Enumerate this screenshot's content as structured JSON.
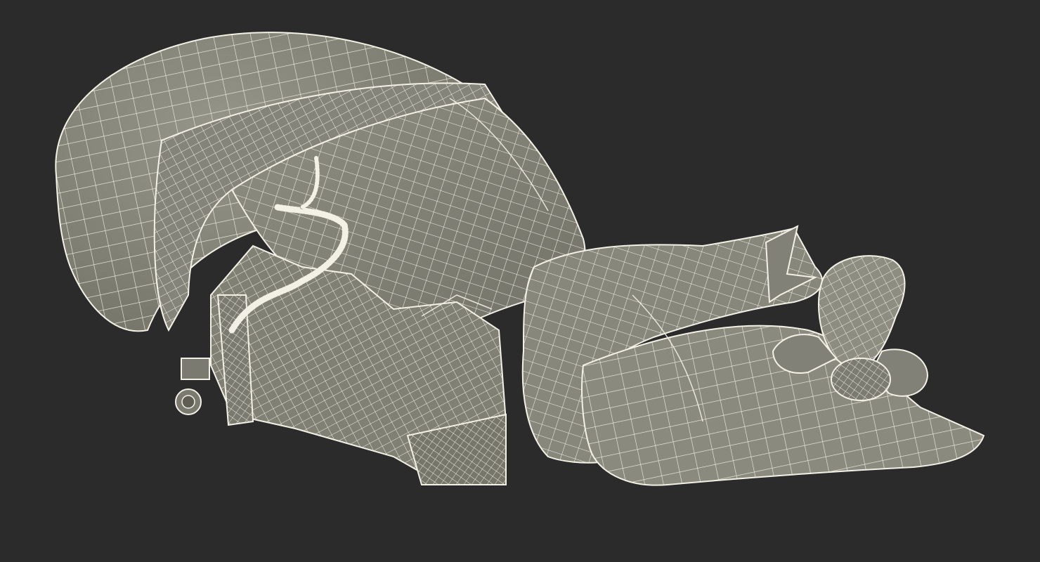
{
  "scene": {
    "subject": "outboard-motor-wireframe",
    "background_color": "#2b2b2b",
    "surface_color": "#8b8b7e",
    "surface_shadow_color": "#6f6f64",
    "wire_color": "#f3f1e6"
  }
}
